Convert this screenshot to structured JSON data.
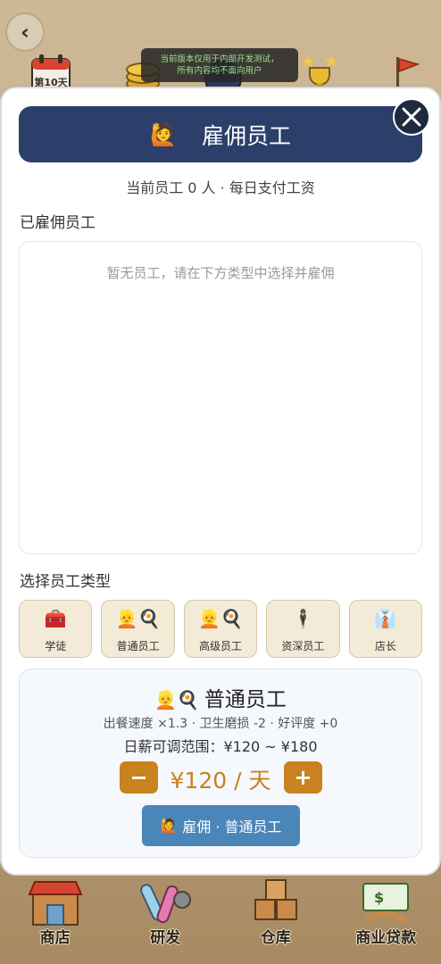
{
  "background": {
    "back_label": "‹",
    "beta_notice_line1": "当前版本仅用于内部开发测试，",
    "beta_notice_line2": "所有内容均不面向用户",
    "top_icons": [
      "calendar-icon",
      "coins-icon",
      "character-icon",
      "trophy-icon",
      "flag-icon"
    ],
    "calendar_label": "第10天",
    "bottom_nav": [
      {
        "label": "商店",
        "icon": "shop-icon"
      },
      {
        "label": "研发",
        "icon": "research-icon"
      },
      {
        "label": "仓库",
        "icon": "warehouse-icon"
      },
      {
        "label": "商业贷款",
        "icon": "loan-icon"
      }
    ]
  },
  "modal": {
    "header_icon": "🙋",
    "title": "雇佣员工",
    "close_label": "×",
    "sub_info": "当前员工 0 人 · 每日支付工资",
    "hired_section_label": "已雇佣员工",
    "empty_text": "暂无员工，请在下方类型中选择并雇佣",
    "type_section_label": "选择员工类型",
    "types": [
      {
        "icon": "🧰",
        "label": "学徒"
      },
      {
        "icon": "👱🍳",
        "label": "普通员工"
      },
      {
        "icon": "👱🍳",
        "label": "高级员工"
      },
      {
        "icon": "🕴",
        "label": "资深员工"
      },
      {
        "icon": "👔",
        "label": "店长"
      }
    ],
    "selected_type_index": 1,
    "detail": {
      "icon": "👱🍳",
      "name": "普通员工",
      "stats": "出餐速度 ×1.3 · 卫生磨损 -2 · 好评度 +0",
      "range": "日薪可调范围：¥120 ~ ¥180",
      "minus_label": "−",
      "plus_label": "+",
      "salary": "¥120 / 天",
      "hire_icon": "🙋",
      "hire_label": "雇佣 · 普通员工"
    }
  },
  "colors": {
    "header_bg": "#2c3f6b",
    "accent_orange": "#c8821e",
    "hire_button": "#4b86b8",
    "type_card_bg": "#f3ead8"
  }
}
